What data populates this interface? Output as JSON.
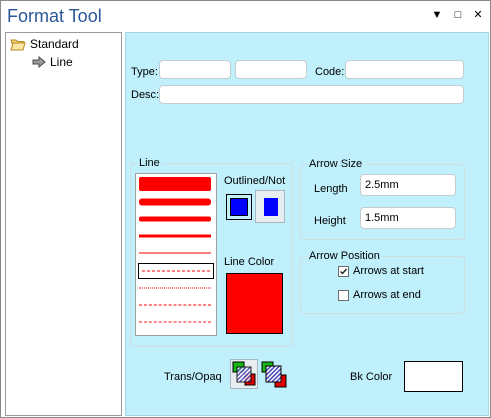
{
  "window": {
    "title": "Format Tool",
    "menu_glyph": "▼",
    "maximize_glyph": "□",
    "close_glyph": "✕"
  },
  "tree": {
    "items": [
      {
        "label": "Standard",
        "icon": "folder-open-icon"
      },
      {
        "label": "Line",
        "icon": "arrow-right-icon"
      }
    ]
  },
  "form": {
    "type_label": "Type:",
    "type_value": "",
    "type2_value": "",
    "code_label": "Code:",
    "code_value": "",
    "desc_label": "Desc:",
    "desc_value": ""
  },
  "line_group": {
    "title": "Line",
    "selected_index": 5
  },
  "outlined": {
    "label": "Outlined/Not",
    "color": "#0000ff"
  },
  "line_color": {
    "label": "Line Color",
    "color": "#ff0000"
  },
  "arrow_size": {
    "title": "Arrow Size",
    "length_label": "Length",
    "length_value": "2.5mm",
    "height_label": "Height",
    "height_value": "1.5mm"
  },
  "arrow_position": {
    "title": "Arrow Position",
    "start_label": "Arrows at start",
    "start_checked": true,
    "end_label": "Arrows at end",
    "end_checked": false
  },
  "trans_opaq": {
    "label": "Trans/Opaq"
  },
  "bk_color": {
    "label": "Bk Color",
    "color": "#ffffff"
  },
  "colors": {
    "panel_bg": "#bff0fb",
    "accent_red": "#ff0000",
    "accent_blue": "#0000ff",
    "title_blue": "#2b5797"
  }
}
